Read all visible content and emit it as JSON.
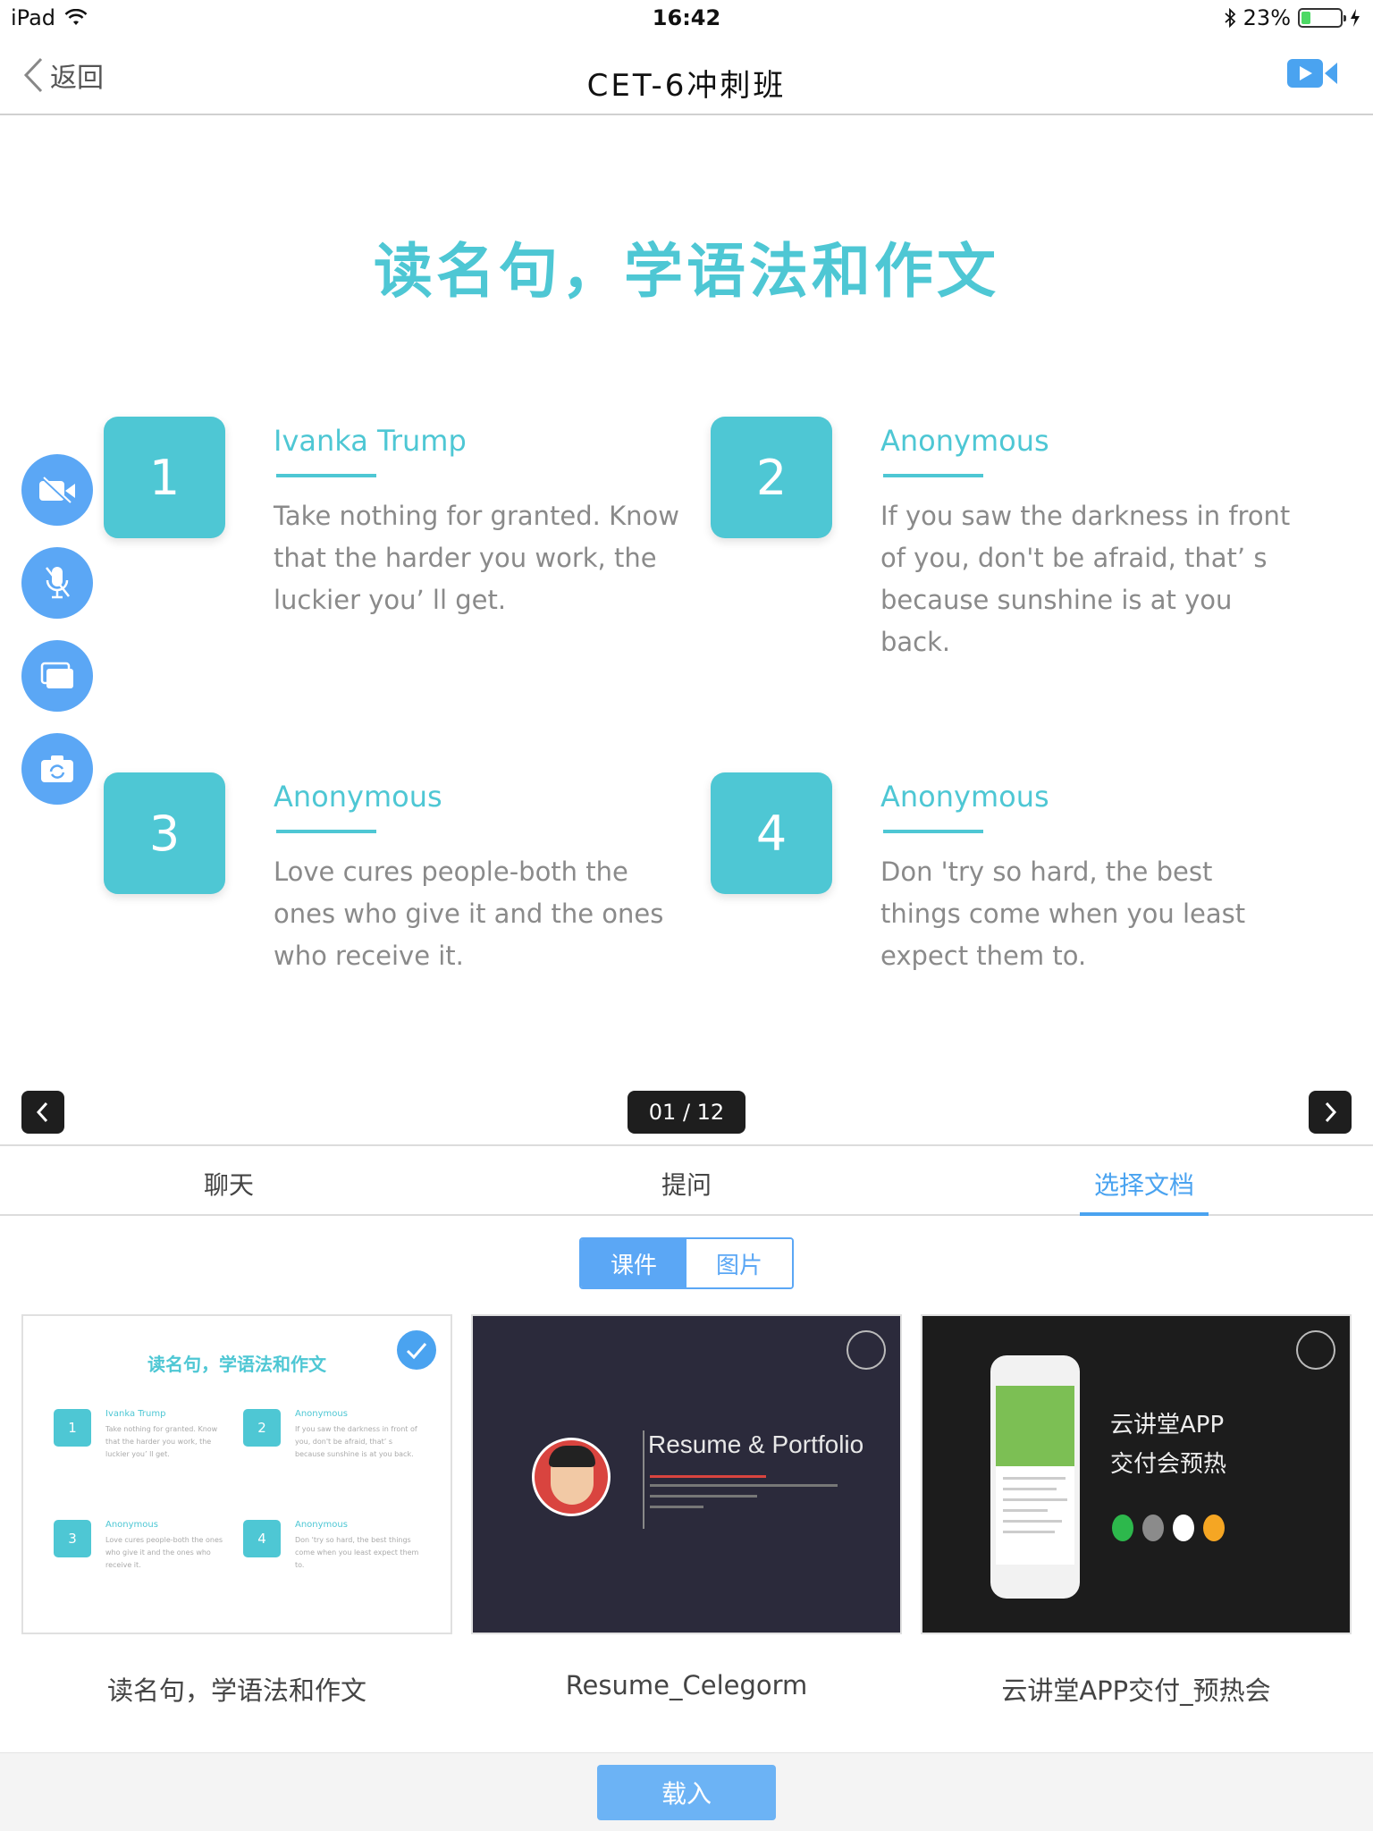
{
  "status_bar": {
    "device": "iPad",
    "time": "16:42",
    "battery": "23%",
    "battery_level": 0.23
  },
  "nav": {
    "back_label": "返回",
    "title": "CET-6冲刺班"
  },
  "slide": {
    "title": "读名句，学语法和作文",
    "quotes": [
      {
        "num": "1",
        "author": "Ivanka Trump",
        "text": "Take nothing for granted. Know that the harder you work, the luckier you’ ll get."
      },
      {
        "num": "2",
        "author": "Anonymous",
        "text": "If you saw the darkness in front of you, don't be afraid, that’ s because sunshine is at you back."
      },
      {
        "num": "3",
        "author": "Anonymous",
        "text": "Love cures people-both the ones who give it and the ones who receive it."
      },
      {
        "num": "4",
        "author": "Anonymous",
        "text": "Don 'try so hard, the best things come when you least expect them to."
      }
    ],
    "page_counter": "01 / 12"
  },
  "tabs": [
    "聊天",
    "提问",
    "选择文档"
  ],
  "active_tab": 2,
  "segment": {
    "courseware": "课件",
    "images": "图片"
  },
  "docs": [
    {
      "name": "读名句，学语法和作文",
      "selected": true
    },
    {
      "name": "Resume_Celegorm",
      "selected": false,
      "thumb_title": "Resume & Portfolio"
    },
    {
      "name": "云讲堂APP交付_预热会",
      "selected": false,
      "thumb_line1": "云讲堂APP",
      "thumb_line2": "交付会预热"
    }
  ],
  "load_button": "载入",
  "colors": {
    "accent_blue": "#4aa3f0",
    "slide_teal": "#4ec7d4",
    "button_blue": "#5ba7f5"
  }
}
